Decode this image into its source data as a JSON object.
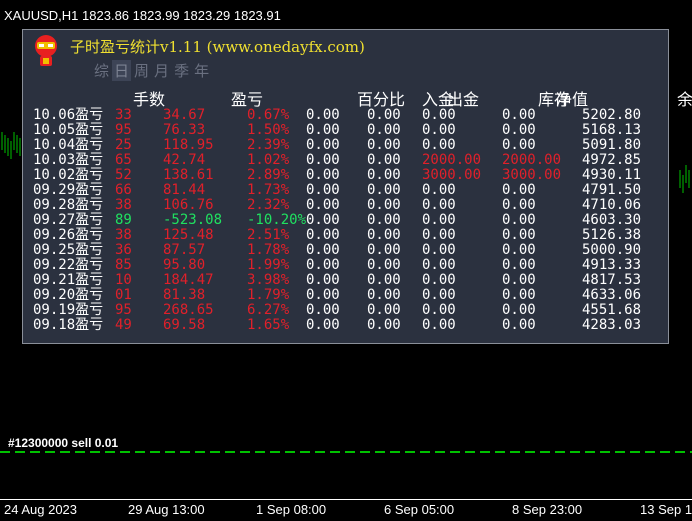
{
  "window": {
    "symbol": "XAUUSD,H1",
    "prices": "1823.86 1823.99 1823.29 1823.91"
  },
  "panel": {
    "title": "子时盈亏统计v1.11 (www.onedayfx.com)",
    "tabs": [
      "综",
      "日",
      "周",
      "月",
      "季",
      "年"
    ],
    "active_tab": "日",
    "headers": [
      "手数",
      "盈亏",
      "百分比",
      "入金",
      "出金",
      "库存",
      "净值",
      "余"
    ],
    "rows": [
      {
        "date": "10.06盈亏",
        "lots": "33",
        "pl": "34.67",
        "pct": "0.67%",
        "c4": "0.00",
        "c5": "0.00",
        "c6": "0.00",
        "c7": "0.00",
        "bal": "5202.80",
        "color": "red"
      },
      {
        "date": "10.05盈亏",
        "lots": "95",
        "pl": "76.33",
        "pct": "1.50%",
        "c4": "0.00",
        "c5": "0.00",
        "c6": "0.00",
        "c7": "0.00",
        "bal": "5168.13",
        "color": "red"
      },
      {
        "date": "10.04盈亏",
        "lots": "25",
        "pl": "118.95",
        "pct": "2.39%",
        "c4": "0.00",
        "c5": "0.00",
        "c6": "0.00",
        "c7": "0.00",
        "bal": "5091.80",
        "color": "red"
      },
      {
        "date": "10.03盈亏",
        "lots": "65",
        "pl": "42.74",
        "pct": "1.02%",
        "c4": "0.00",
        "c5": "0.00",
        "c6": "2000.00",
        "c7": "2000.00",
        "bal": "4972.85",
        "color": "red"
      },
      {
        "date": "10.02盈亏",
        "lots": "52",
        "pl": "138.61",
        "pct": "2.89%",
        "c4": "0.00",
        "c5": "0.00",
        "c6": "3000.00",
        "c7": "3000.00",
        "bal": "4930.11",
        "color": "red"
      },
      {
        "date": "09.29盈亏",
        "lots": "66",
        "pl": "81.44",
        "pct": "1.73%",
        "c4": "0.00",
        "c5": "0.00",
        "c6": "0.00",
        "c7": "0.00",
        "bal": "4791.50",
        "color": "red"
      },
      {
        "date": "09.28盈亏",
        "lots": "38",
        "pl": "106.76",
        "pct": "2.32%",
        "c4": "0.00",
        "c5": "0.00",
        "c6": "0.00",
        "c7": "0.00",
        "bal": "4710.06",
        "color": "red"
      },
      {
        "date": "09.27盈亏",
        "lots": "89",
        "pl": "-523.08",
        "pct": "-10.20%",
        "c4": "0.00",
        "c5": "0.00",
        "c6": "0.00",
        "c7": "0.00",
        "bal": "4603.30",
        "color": "green"
      },
      {
        "date": "09.26盈亏",
        "lots": "38",
        "pl": "125.48",
        "pct": "2.51%",
        "c4": "0.00",
        "c5": "0.00",
        "c6": "0.00",
        "c7": "0.00",
        "bal": "5126.38",
        "color": "red"
      },
      {
        "date": "09.25盈亏",
        "lots": "36",
        "pl": "87.57",
        "pct": "1.78%",
        "c4": "0.00",
        "c5": "0.00",
        "c6": "0.00",
        "c7": "0.00",
        "bal": "5000.90",
        "color": "red"
      },
      {
        "date": "09.22盈亏",
        "lots": "85",
        "pl": "95.80",
        "pct": "1.99%",
        "c4": "0.00",
        "c5": "0.00",
        "c6": "0.00",
        "c7": "0.00",
        "bal": "4913.33",
        "color": "red"
      },
      {
        "date": "09.21盈亏",
        "lots": "10",
        "pl": "184.47",
        "pct": "3.98%",
        "c4": "0.00",
        "c5": "0.00",
        "c6": "0.00",
        "c7": "0.00",
        "bal": "4817.53",
        "color": "red"
      },
      {
        "date": "09.20盈亏",
        "lots": "01",
        "pl": "81.38",
        "pct": "1.79%",
        "c4": "0.00",
        "c5": "0.00",
        "c6": "0.00",
        "c7": "0.00",
        "bal": "4633.06",
        "color": "red"
      },
      {
        "date": "09.19盈亏",
        "lots": "95",
        "pl": "268.65",
        "pct": "6.27%",
        "c4": "0.00",
        "c5": "0.00",
        "c6": "0.00",
        "c7": "0.00",
        "bal": "4551.68",
        "color": "red"
      },
      {
        "date": "09.18盈亏",
        "lots": "49",
        "pl": "69.58",
        "pct": "1.65%",
        "c4": "0.00",
        "c5": "0.00",
        "c6": "0.00",
        "c7": "0.00",
        "bal": "4283.03",
        "color": "red"
      }
    ]
  },
  "chart": {
    "order_label": "#12300000 sell 0.01",
    "x_ticks": [
      "24 Aug 2023",
      "29 Aug 13:00",
      "1 Sep 08:00",
      "6 Sep 05:00",
      "8 Sep 23:00",
      "13 Sep 1"
    ],
    "colors": {
      "bull": "#00c000",
      "bear": "#00c000",
      "panel": "#2b313f",
      "loss": "#e0202a",
      "gain": "#20e060"
    }
  }
}
